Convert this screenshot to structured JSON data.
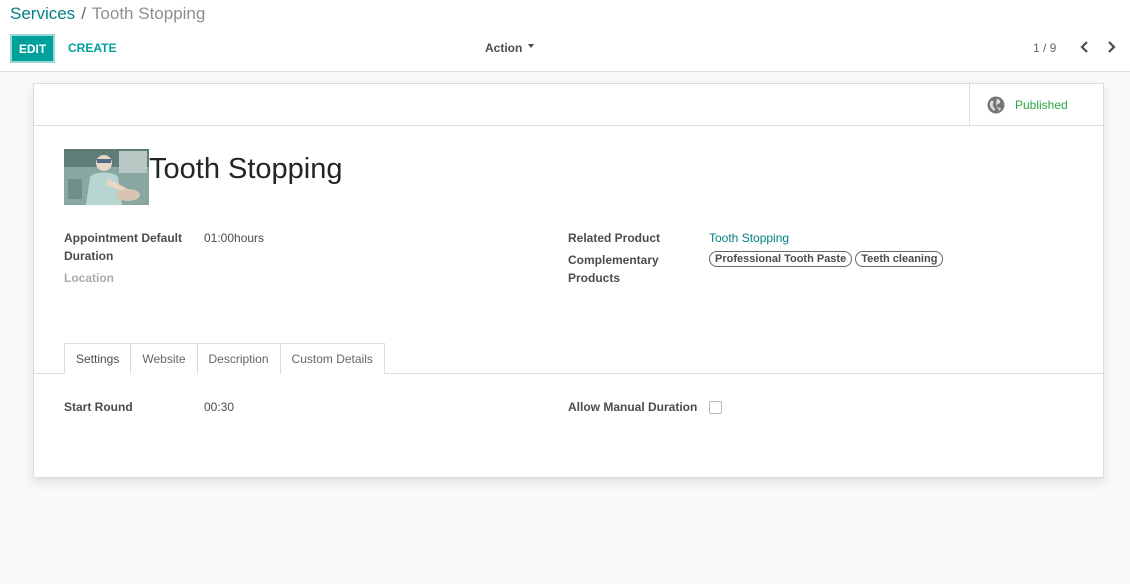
{
  "breadcrumb": {
    "parent": "Services",
    "separator": "/",
    "current": "Tooth Stopping"
  },
  "toolbar": {
    "edit_label": "EDIT",
    "create_label": "CREATE",
    "action_label": "Action",
    "pager_text": "1 / 9"
  },
  "status": {
    "published_label": "Published",
    "published_color": "#28a745"
  },
  "record": {
    "title": "Tooth Stopping",
    "image_icon": "dentist-photo"
  },
  "fields": {
    "duration_label_line1": "Appointment Default",
    "duration_label_line2": "Duration",
    "duration_value": "01:00hours",
    "location_label": "Location",
    "related_product_label": "Related Product",
    "related_product_value": "Tooth Stopping",
    "complementary_label_line1": "Complementary",
    "complementary_label_line2": "Products",
    "complementary_tags": [
      "Professional Tooth Paste",
      "Teeth cleaning"
    ]
  },
  "tabs": [
    {
      "label": "Settings",
      "active": true
    },
    {
      "label": "Website",
      "active": false
    },
    {
      "label": "Description",
      "active": false
    },
    {
      "label": "Custom Details",
      "active": false
    }
  ],
  "settings": {
    "start_round_label": "Start Round",
    "start_round_value": "00:30",
    "allow_manual_label": "Allow Manual Duration",
    "allow_manual_checked": false
  },
  "colors": {
    "accent": "#00a09d",
    "link": "#017e84"
  }
}
